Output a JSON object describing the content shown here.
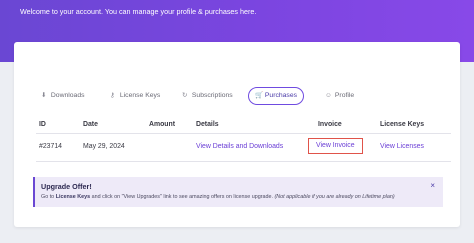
{
  "header": {
    "welcome_text": "Welcome to your account. You can manage your profile & purchases here."
  },
  "tabs": [
    {
      "label": "Downloads",
      "icon": "download-icon",
      "glyph": "⬇"
    },
    {
      "label": "License Keys",
      "icon": "key-icon",
      "glyph": "⚷"
    },
    {
      "label": "Subscriptions",
      "icon": "refresh-icon",
      "glyph": "↻"
    },
    {
      "label": "Purchases",
      "icon": "cart-icon",
      "glyph": "🛒",
      "active": true
    },
    {
      "label": "Profile",
      "icon": "user-icon",
      "glyph": "☺"
    }
  ],
  "table": {
    "columns": [
      "ID",
      "Date",
      "Amount",
      "Details",
      "Invoice",
      "License Keys"
    ],
    "rows": [
      {
        "id": "#23714",
        "date": "May 29, 2024",
        "amount": "",
        "details": "View Details and Downloads",
        "invoice": "View Invoice",
        "license_keys": "View Licenses"
      }
    ]
  },
  "notice": {
    "title": "Upgrade Offer!",
    "text_prefix": "Go to ",
    "text_bold": "License Keys",
    "text_middle": " and click on \"View Upgrades\" link to see amazing offers on license upgrade. ",
    "text_italic": "(Not applicable if you are already on Lifetime plan)",
    "close_glyph": "×"
  },
  "colors": {
    "hero": "#7346dc",
    "accent": "#6b3fd6",
    "highlight_border": "#e0534a"
  }
}
